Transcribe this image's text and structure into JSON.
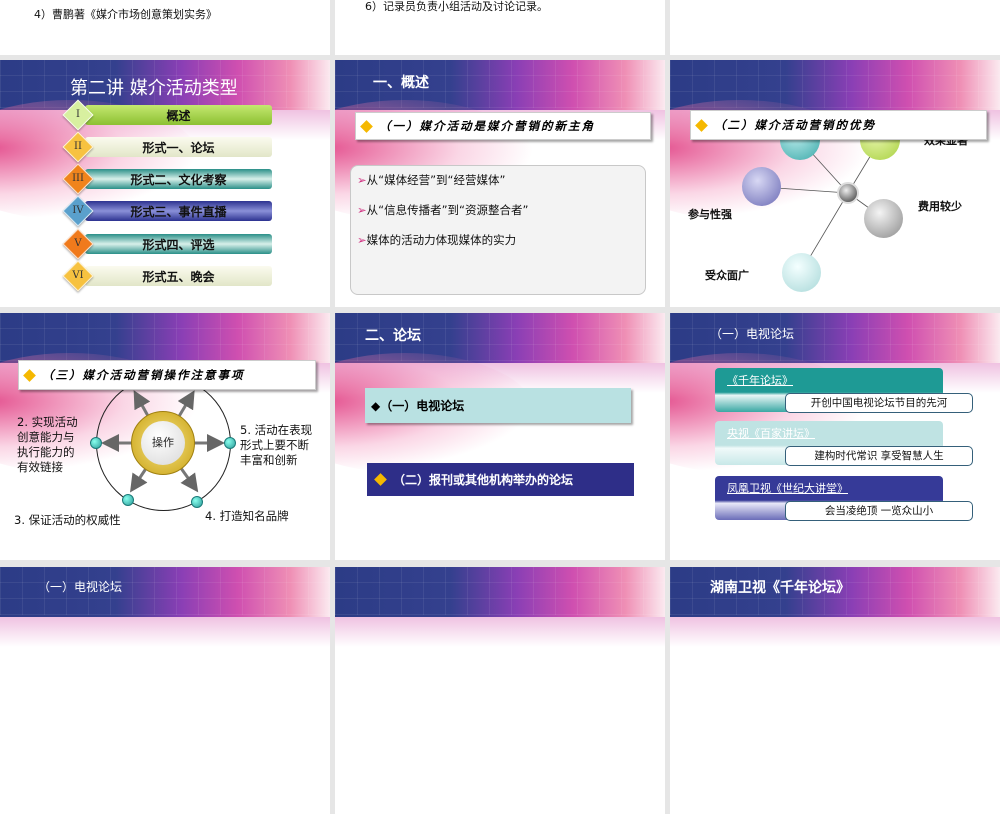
{
  "slides_row0": {
    "s1_text": "4）曹鹏著《媒介市场创意策划实务》",
    "s2_text": "6）记录员负责小组活动及讨论记录。"
  },
  "slide_types": {
    "title": "第二讲  媒介活动类型",
    "items": [
      {
        "num": "I",
        "label": "概述"
      },
      {
        "num": "II",
        "label": "形式一、论坛"
      },
      {
        "num": "III",
        "label": "形式二、文化考察"
      },
      {
        "num": "IV",
        "label": "形式三、事件直播"
      },
      {
        "num": "V",
        "label": "形式四、评选"
      },
      {
        "num": "VI",
        "label": "形式五、晚会"
      }
    ]
  },
  "slide_overview": {
    "title": "一、概述",
    "header": "（一）媒介活动是媒介营销的新主角",
    "bullets": [
      "从“媒体经营”到“经营媒体”",
      "从“信息传播者”到“资源整合者”",
      "媒体的活动力体现媒体的实力"
    ]
  },
  "slide_advantages": {
    "header": "（二）媒介活动营销的优势",
    "labels": {
      "effect": "效果显著",
      "cost": "费用较少",
      "participation": "参与性强",
      "audience": "受众面广"
    }
  },
  "slide_notes": {
    "header": "（三）媒介活动营销操作注意事项",
    "center": "操作",
    "p2": [
      "2. 实现活动",
      "创意能力与",
      "执行能力的",
      "有效链接"
    ],
    "p5": [
      "5. 活动在表现",
      "形式上要不断",
      "丰富和创新"
    ],
    "p3": "3. 保证活动的权威性",
    "p4": "4. 打造知名品牌"
  },
  "slide_forum": {
    "title": "二、论坛",
    "box1": "（一）电视论坛",
    "box2": "（二）报刊或其他机构举办的论坛"
  },
  "slide_tv_forum": {
    "title": "（一）电视论坛",
    "cards": [
      {
        "link": "《千年论坛》",
        "slogan": "开创中国电视论坛节目的先河"
      },
      {
        "link": "央视《百家讲坛》",
        "slogan": "建构时代常识 享受智慧人生"
      },
      {
        "link": "凤凰卫视《世纪大讲堂》",
        "slogan": "会当凌绝顶 一览众山小"
      }
    ]
  },
  "slides_row3": {
    "s1_title": "（一）电视论坛",
    "s3_title": "湖南卫视《千年论坛》"
  }
}
